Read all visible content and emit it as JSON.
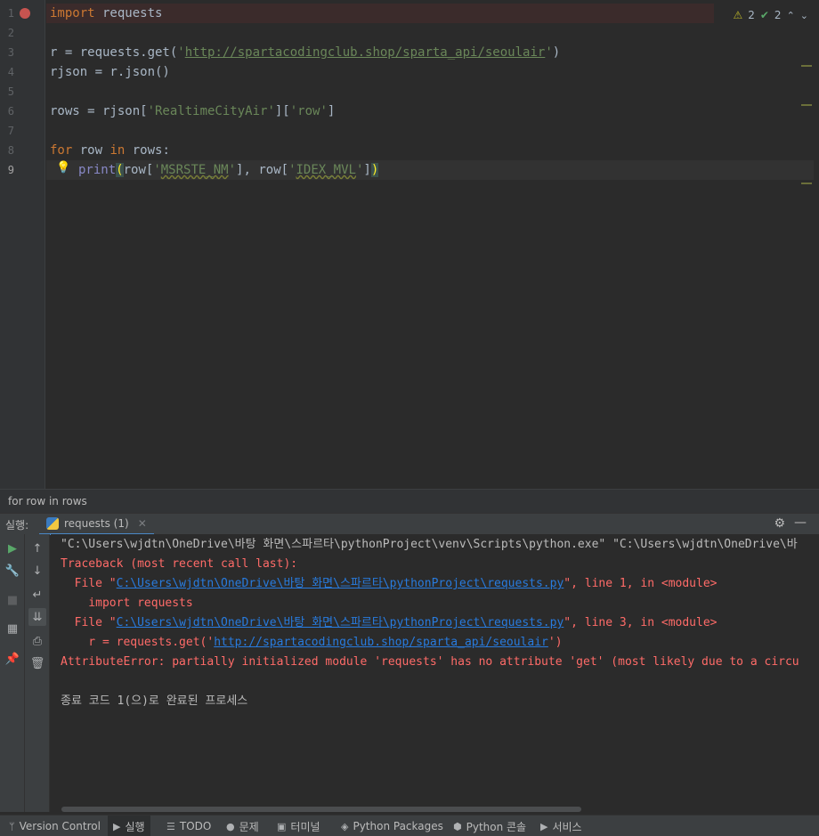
{
  "editor": {
    "line_numbers": [
      "1",
      "2",
      "3",
      "4",
      "5",
      "6",
      "7",
      "8",
      "9"
    ],
    "line1": {
      "kw": "import",
      "rest": " requests"
    },
    "line3": {
      "pre": "r = requests.get(",
      "q1": "'",
      "url": "http://spartacodingclub.shop/sparta_api/seoulair",
      "q2": "'",
      "post": ")"
    },
    "line4": "rjson = r.json()",
    "line6": {
      "pre": "rows = rjson[",
      "s1": "'RealtimeCityAir'",
      "mid": "][",
      "s2": "'row'",
      "post": "]"
    },
    "line8": {
      "kw1": "for",
      "a": " row ",
      "kw2": "in",
      "b": " rows:"
    },
    "line9": {
      "fn": "print",
      "open": "(",
      "a": "row[",
      "s1q": "'",
      "s1": "MSRSTE_NM",
      "s1e": "'",
      "b": "], row[",
      "s2q": "'",
      "s2": "IDEX_MVL",
      "s2e": "'",
      "c": "]",
      "close": ")"
    },
    "inspection": {
      "warnings": "2",
      "typos": "2"
    }
  },
  "breadcrumb": "for row in rows",
  "run": {
    "label": "실행:",
    "tab": "requests (1)"
  },
  "console": {
    "cmd": "\"C:\\Users\\wjdtn\\OneDrive\\바탕 화면\\스파르타\\pythonProject\\venv\\Scripts\\python.exe\" \"C:\\Users\\wjdtn\\OneDrive\\바",
    "tb": "Traceback (most recent call last):",
    "f1_pre": "  File \"",
    "f1_link": "C:\\Users\\wjdtn\\OneDrive\\바탕 화면\\스파르타\\pythonProject\\requests.py",
    "f1_post": "\", line 1, in <module>",
    "f1_code": "    import requests",
    "f2_pre": "  File \"",
    "f2_link": "C:\\Users\\wjdtn\\OneDrive\\바탕 화면\\스파르타\\pythonProject\\requests.py",
    "f2_post": "\", line 3, in <module>",
    "f2_code_pre": "    r = requests.get('",
    "f2_code_link": "http://spartacodingclub.shop/sparta_api/seoulair",
    "f2_code_post": "')",
    "err": "AttributeError: partially initialized module 'requests' has no attribute 'get' (most likely due to a circu",
    "exit": "종료 코드 1(으)로 완료된 프로세스"
  },
  "toolstrip": {
    "items": [
      "Version Control",
      "실행",
      "TODO",
      "문제",
      "터미널",
      "Python Packages",
      "Python 콘솔",
      "서비스"
    ]
  },
  "colors": {
    "error": "#ff6b68",
    "link": "#287bde",
    "keyword": "#cc7832",
    "string": "#6a8759"
  }
}
